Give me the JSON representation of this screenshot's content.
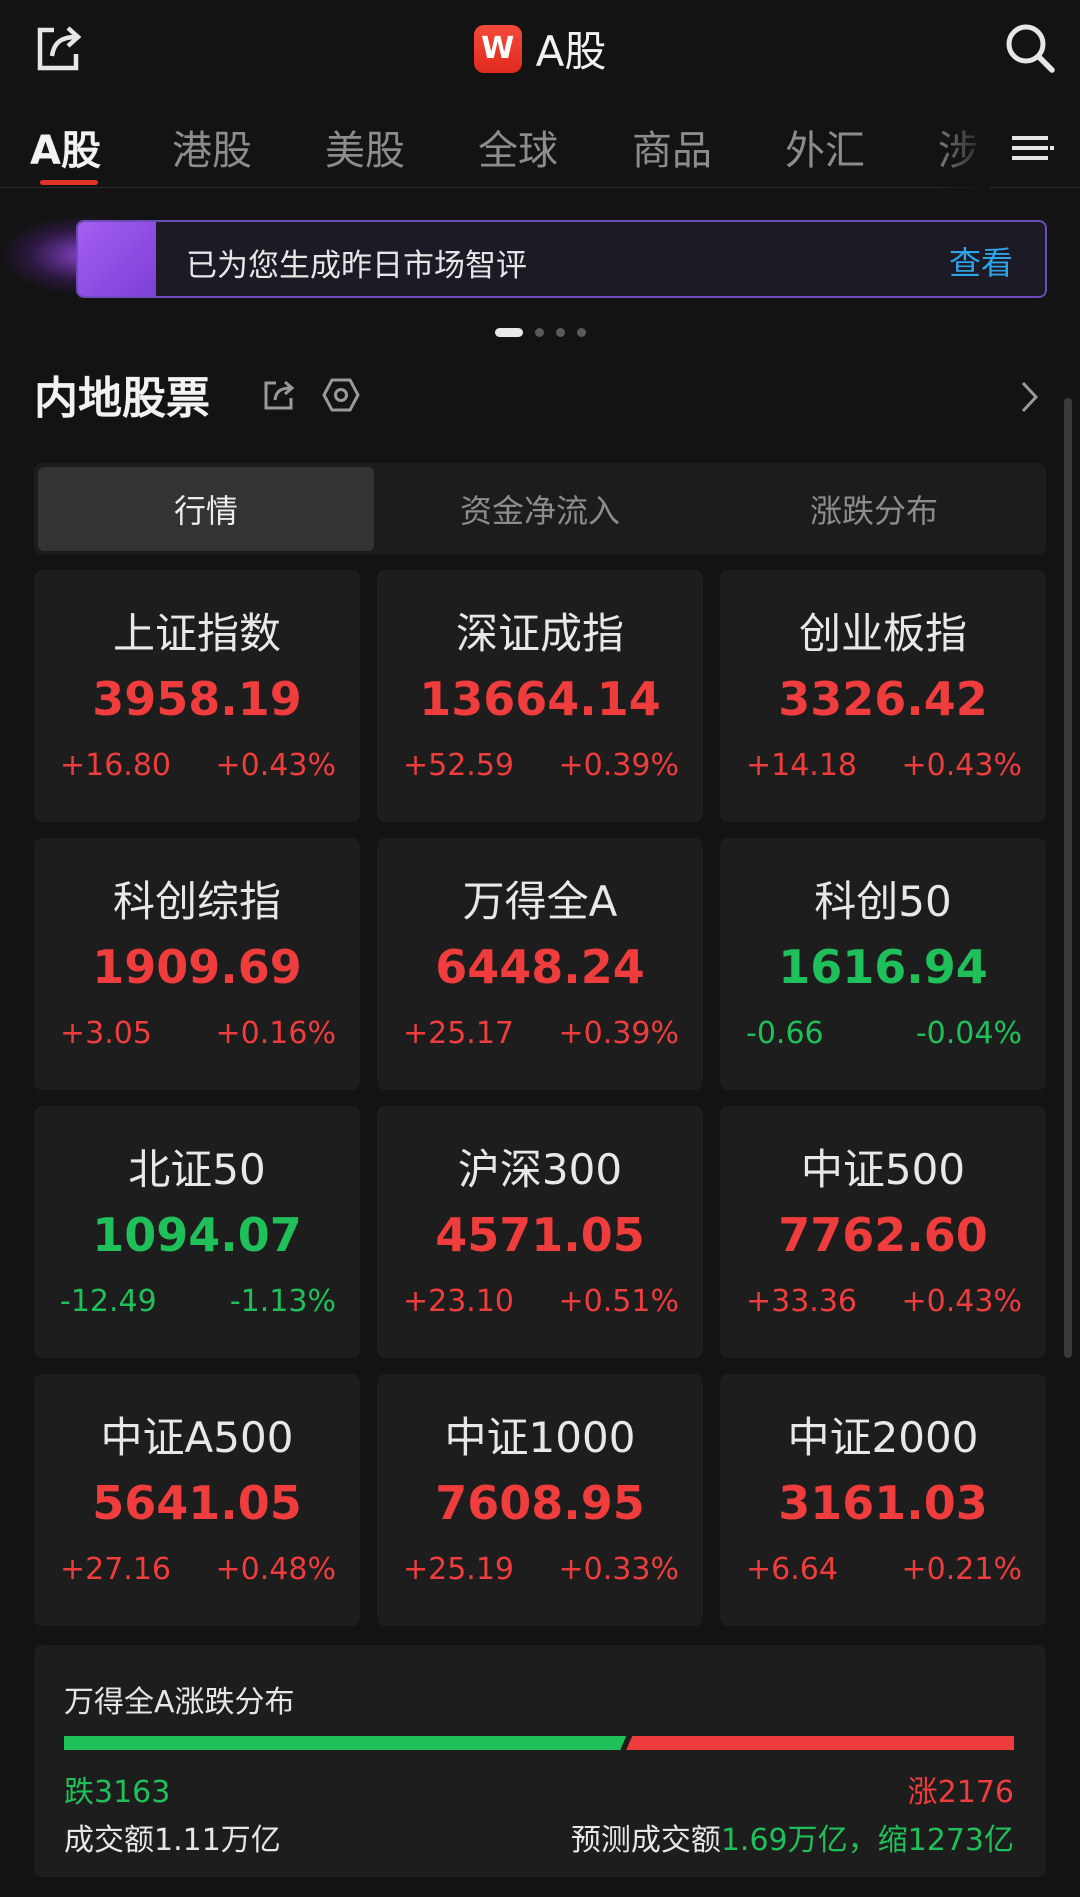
{
  "header": {
    "title": "A股",
    "logo_text": "W",
    "icons": [
      "share-icon",
      "search-icon"
    ]
  },
  "tabs": [
    {
      "label": "A股",
      "active": true
    },
    {
      "label": "港股"
    },
    {
      "label": "美股"
    },
    {
      "label": "全球"
    },
    {
      "label": "商品"
    },
    {
      "label": "外汇"
    },
    {
      "label": "涉"
    }
  ],
  "banner": {
    "text": "已为您生成昨日市场智评",
    "link": "查看"
  },
  "carousel": {
    "total": 4,
    "current": 1
  },
  "section": {
    "title": "内地股票"
  },
  "segment": {
    "items": [
      "行情",
      "资金净流入",
      "涨跌分布"
    ],
    "active": 0
  },
  "indices": [
    {
      "name": "上证指数",
      "value": "3958.19",
      "change": "+16.80",
      "pct": "+0.43%",
      "dir": "up"
    },
    {
      "name": "深证成指",
      "value": "13664.14",
      "change": "+52.59",
      "pct": "+0.39%",
      "dir": "up"
    },
    {
      "name": "创业板指",
      "value": "3326.42",
      "change": "+14.18",
      "pct": "+0.43%",
      "dir": "up"
    },
    {
      "name": "科创综指",
      "value": "1909.69",
      "change": "+3.05",
      "pct": "+0.16%",
      "dir": "up"
    },
    {
      "name": "万得全A",
      "value": "6448.24",
      "change": "+25.17",
      "pct": "+0.39%",
      "dir": "up"
    },
    {
      "name": "科创50",
      "value": "1616.94",
      "change": "-0.66",
      "pct": "-0.04%",
      "dir": "down"
    },
    {
      "name": "北证50",
      "value": "1094.07",
      "change": "-12.49",
      "pct": "-1.13%",
      "dir": "down"
    },
    {
      "name": "沪深300",
      "value": "4571.05",
      "change": "+23.10",
      "pct": "+0.51%",
      "dir": "up"
    },
    {
      "name": "中证500",
      "value": "7762.60",
      "change": "+33.36",
      "pct": "+0.43%",
      "dir": "up"
    },
    {
      "name": "中证A500",
      "value": "5641.05",
      "change": "+27.16",
      "pct": "+0.48%",
      "dir": "up"
    },
    {
      "name": "中证1000",
      "value": "7608.95",
      "change": "+25.19",
      "pct": "+0.33%",
      "dir": "up"
    },
    {
      "name": "中证2000",
      "value": "3161.03",
      "change": "+6.64",
      "pct": "+0.21%",
      "dir": "up"
    }
  ],
  "distribution": {
    "title": "万得全A涨跌分布",
    "fall_label": "跌3163",
    "rise_label": "涨2176",
    "fall_count": 3163,
    "rise_count": 2176,
    "volume": "成交额1.11万亿",
    "forecast_prefix": "预测成交额",
    "forecast_value": "1.69万亿，缩1273亿",
    "colors": {
      "rise": "#ef3c3c",
      "fall": "#1fbf5a"
    }
  }
}
